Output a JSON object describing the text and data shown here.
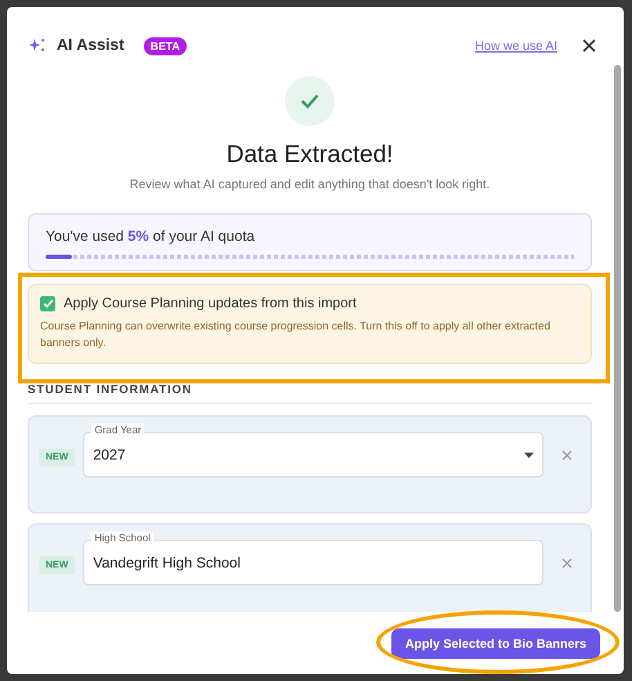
{
  "header": {
    "title": "AI Assist",
    "badge": "BETA",
    "link": "How we use AI"
  },
  "status": {
    "title": "Data Extracted!",
    "subtitle": "Review what AI captured and edit anything that doesn't look right."
  },
  "quota": {
    "text": "You've used **5%** of your AI quota",
    "level": 0.05
  },
  "course_planning": {
    "label": "Apply Course Planning updates from this import",
    "checked": true,
    "description": "Course Planning can overwrite existing course progression cells. Turn this off to apply all other extracted banners only."
  },
  "section": {
    "title": "STUDENT INFORMATION"
  },
  "fields": [
    {
      "badge": "NEW",
      "label": "Grad Year",
      "value": "2027",
      "kind": "dropdown"
    },
    {
      "badge": "NEW",
      "label": "High School",
      "value": "Vandegrift High School",
      "kind": "text"
    }
  ],
  "footer": {
    "button": "Apply Selected to Bio Banners"
  },
  "annotations": [
    {
      "kind": "rectangle"
    },
    {
      "kind": "ellipse"
    }
  ]
}
